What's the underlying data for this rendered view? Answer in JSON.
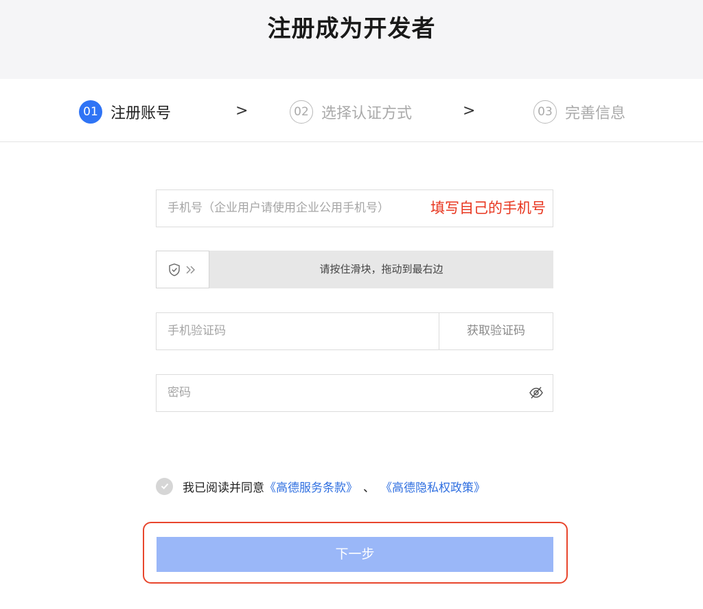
{
  "page": {
    "title": "注册成为开发者"
  },
  "steps": [
    {
      "num": "01",
      "label": "注册账号",
      "state": "active"
    },
    {
      "num": "02",
      "label": "选择认证方式",
      "state": "inactive"
    },
    {
      "num": "03",
      "label": "完善信息",
      "state": "inactive"
    }
  ],
  "step_separator": ">",
  "phone": {
    "placeholder": "手机号（企业用户请使用企业公用手机号）",
    "annotation": "填写自己的手机号"
  },
  "slider": {
    "text": "请按住滑块，拖动到最右边",
    "icons": [
      "shield-check-icon",
      "double-chevron-right-icon"
    ]
  },
  "sms_code": {
    "placeholder": "手机验证码",
    "button_label": "获取验证码"
  },
  "password": {
    "placeholder": "密码",
    "icon": "eye-hidden-icon"
  },
  "agreement": {
    "prefix": "我已阅读并同意",
    "link1": "《高德服务条款》",
    "separator": "、",
    "link2": "《高德隐私权政策》"
  },
  "next_button": {
    "label": "下一步"
  },
  "colors": {
    "accent": "#2f74f5",
    "annotation_red": "#e8361f",
    "button_disabled": "#9ab7f8",
    "link": "#2f6fe0"
  }
}
